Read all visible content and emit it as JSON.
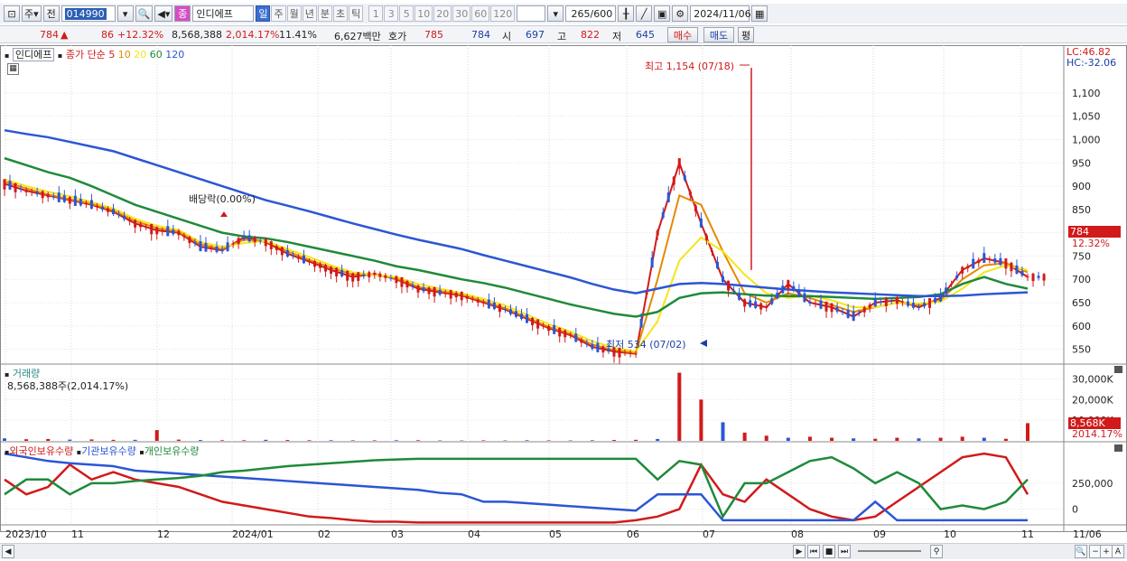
{
  "toolbar": {
    "market_label": "주",
    "prev_label": "전",
    "stock_code": "014990",
    "stock_name_badge": "종",
    "stock_name": "인디에프",
    "periods": [
      "일",
      "주",
      "월",
      "년",
      "분",
      "초",
      "틱"
    ],
    "active_period": "일",
    "num_periods": [
      "1",
      "3",
      "5",
      "10",
      "20",
      "30",
      "60",
      "120"
    ],
    "count_display": "265",
    "count_total": "/600",
    "date": "2024/11/06"
  },
  "quote": {
    "price": "784",
    "change_arrow": "▲",
    "change": "86",
    "change_pct": "+12.32%",
    "volume": "8,568,388",
    "volume_ratio": "2,014.17%",
    "turnover": "11.41%",
    "amount": "6,627백만",
    "hoga_label": "호가",
    "ask": "785",
    "bid": "784",
    "open_label": "시",
    "open": "697",
    "high_label": "고",
    "high": "822",
    "low_label": "저",
    "low": "645",
    "buy_btn": "매수",
    "sell_btn": "매도",
    "eval_btn": "평"
  },
  "price_pane": {
    "stock_label": "인디에프",
    "ma_prefix": "종가 단순",
    "ma_periods": [
      "5",
      "10",
      "20",
      "60",
      "120"
    ],
    "ma_colors": [
      "#d11a1a",
      "#e58a00",
      "#f5e51a",
      "#1f8a3a",
      "#2b56d4"
    ],
    "lc_label": "LC:46.82",
    "hc_label": "HC:-32.06",
    "high_annot": "최고 1,154 (07/18)",
    "low_annot": "최저 534 (07/02)",
    "dividend_annot": "배당락(0.00%)",
    "y_ticks": [
      "1,100",
      "1,050",
      "1,000",
      "950",
      "900",
      "850",
      "800",
      "750",
      "700",
      "650",
      "600",
      "550"
    ],
    "last_price_tag": "784",
    "last_pct_tag": "12.32%"
  },
  "volume_pane": {
    "title": "거래량",
    "value_line": "8,568,388주(2,014.17%)",
    "y_ticks": [
      "30,000K",
      "20,000K",
      "10,000K"
    ],
    "last_tag": "8,568K",
    "last_pct_tag": "2014.17%"
  },
  "holding_pane": {
    "series_names": [
      "외국인보유수량",
      "기관보유수량",
      "개인보유수량"
    ],
    "series_colors": [
      "#d11a1a",
      "#2b56d4",
      "#1f8a3a"
    ],
    "y_ticks": [
      "250,000",
      "0"
    ]
  },
  "x_axis": {
    "labels": [
      "2023/10",
      "11",
      "12",
      "2024/01",
      "02",
      "03",
      "04",
      "05",
      "06",
      "07",
      "08",
      "09",
      "10",
      "11",
      "11/06"
    ]
  },
  "chart_data": {
    "type": "candlestick",
    "price_range": [
      520,
      1160
    ],
    "series": [
      {
        "name": "5",
        "values": [
          905,
          890,
          880,
          870,
          860,
          845,
          820,
          805,
          800,
          770,
          762,
          790,
          780,
          755,
          738,
          720,
          705,
          712,
          700,
          680,
          672,
          665,
          650,
          635,
          615,
          595,
          580,
          555,
          545,
          540,
          800,
          950,
          820,
          700,
          650,
          640,
          690,
          650,
          640,
          620,
          650,
          655,
          640,
          660,
          720,
          745,
          735,
          705
        ]
      },
      {
        "name": "10",
        "values": [
          910,
          895,
          882,
          872,
          862,
          848,
          825,
          810,
          802,
          775,
          765,
          785,
          782,
          760,
          742,
          725,
          710,
          710,
          702,
          684,
          675,
          667,
          653,
          638,
          618,
          598,
          583,
          560,
          548,
          542,
          700,
          880,
          860,
          760,
          670,
          650,
          670,
          660,
          645,
          630,
          640,
          650,
          645,
          655,
          700,
          730,
          735,
          715
        ]
      },
      {
        "name": "20",
        "values": [
          915,
          900,
          888,
          878,
          866,
          852,
          830,
          815,
          806,
          780,
          770,
          778,
          782,
          765,
          748,
          730,
          715,
          710,
          705,
          690,
          680,
          670,
          658,
          644,
          624,
          604,
          588,
          567,
          553,
          545,
          610,
          740,
          790,
          760,
          710,
          670,
          660,
          665,
          655,
          640,
          640,
          650,
          648,
          652,
          680,
          715,
          730,
          720
        ]
      },
      {
        "name": "60",
        "values": [
          960,
          945,
          930,
          918,
          900,
          880,
          860,
          845,
          830,
          815,
          800,
          792,
          788,
          780,
          770,
          760,
          750,
          740,
          728,
          720,
          710,
          700,
          692,
          682,
          670,
          658,
          646,
          636,
          626,
          620,
          630,
          660,
          670,
          672,
          668,
          665,
          664,
          664,
          662,
          660,
          658,
          660,
          662,
          668,
          690,
          705,
          690,
          680
        ]
      },
      {
        "name": "120",
        "values": [
          1020,
          1012,
          1005,
          995,
          985,
          975,
          960,
          945,
          930,
          915,
          900,
          885,
          870,
          858,
          846,
          833,
          820,
          808,
          796,
          785,
          775,
          765,
          752,
          740,
          728,
          716,
          704,
          690,
          678,
          670,
          680,
          690,
          692,
          690,
          686,
          682,
          678,
          675,
          672,
          670,
          668,
          666,
          664,
          664,
          665,
          668,
          670,
          672
        ]
      }
    ],
    "volume": [
      1200,
      800,
      900,
      600,
      700,
      500,
      500,
      5200,
      600,
      400,
      300,
      300,
      500,
      400,
      300,
      300,
      250,
      250,
      300,
      300,
      200,
      200,
      250,
      200,
      300,
      250,
      200,
      300,
      400,
      500,
      900,
      33000,
      20000,
      9000,
      4000,
      2500,
      1500,
      2000,
      1500,
      1200,
      1000,
      1500,
      1200,
      1500,
      2000,
      1500,
      1000,
      8568
    ],
    "holdings": {
      "foreign": [
        60,
        40,
        50,
        80,
        60,
        70,
        60,
        55,
        50,
        40,
        30,
        25,
        20,
        15,
        10,
        8,
        5,
        3,
        3,
        2,
        2,
        2,
        2,
        2,
        2,
        2,
        2,
        2,
        2,
        5,
        10,
        20,
        80,
        40,
        30,
        60,
        40,
        20,
        10,
        5,
        10,
        30,
        50,
        70,
        90,
        95,
        90,
        40
      ],
      "institution": [
        95,
        90,
        85,
        82,
        80,
        78,
        72,
        70,
        68,
        66,
        64,
        62,
        60,
        58,
        56,
        54,
        52,
        50,
        48,
        46,
        42,
        40,
        30,
        30,
        28,
        26,
        24,
        22,
        20,
        18,
        40,
        40,
        40,
        5,
        5,
        5,
        5,
        5,
        5,
        5,
        30,
        5,
        5,
        5,
        5,
        5,
        5,
        5
      ],
      "individual": [
        40,
        60,
        60,
        40,
        55,
        55,
        58,
        60,
        62,
        65,
        70,
        72,
        75,
        78,
        80,
        82,
        84,
        86,
        87,
        88,
        88,
        88,
        88,
        88,
        88,
        88,
        88,
        88,
        88,
        88,
        60,
        85,
        80,
        10,
        55,
        55,
        70,
        85,
        90,
        75,
        55,
        70,
        55,
        20,
        25,
        20,
        30,
        60
      ]
    }
  }
}
